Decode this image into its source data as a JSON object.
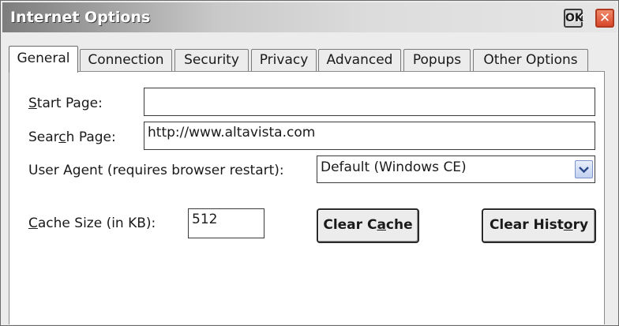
{
  "window": {
    "title": "Internet Options",
    "ok_label": "OK",
    "close_symbol": "✕"
  },
  "tabs": [
    {
      "label": "General",
      "active": true
    },
    {
      "label": "Connection",
      "active": false
    },
    {
      "label": "Security",
      "active": false
    },
    {
      "label": "Privacy",
      "active": false
    },
    {
      "label": "Advanced",
      "active": false
    },
    {
      "label": "Popups",
      "active": false
    },
    {
      "label": "Other Options",
      "active": false
    }
  ],
  "general": {
    "start_page": {
      "label_first": "S",
      "label_rest": "tart Page:",
      "value": ""
    },
    "search_page": {
      "label_pre": "Sear",
      "label_u": "c",
      "label_post": "h Page:",
      "value": "http://www.altavista.com"
    },
    "user_agent": {
      "label": "User Agent (requires browser restart):",
      "value": "Default (Windows CE)"
    },
    "cache_size": {
      "label_first": "C",
      "label_rest": "ache Size (in KB):",
      "value": "512"
    },
    "clear_cache": {
      "pre": "Clear C",
      "u": "a",
      "post": "che"
    },
    "clear_history": {
      "pre": "Clear Hist",
      "u": "o",
      "post": "ry"
    }
  },
  "colors": {
    "close_button": "#d8472a",
    "select_arrow": "#c2d1f0"
  }
}
